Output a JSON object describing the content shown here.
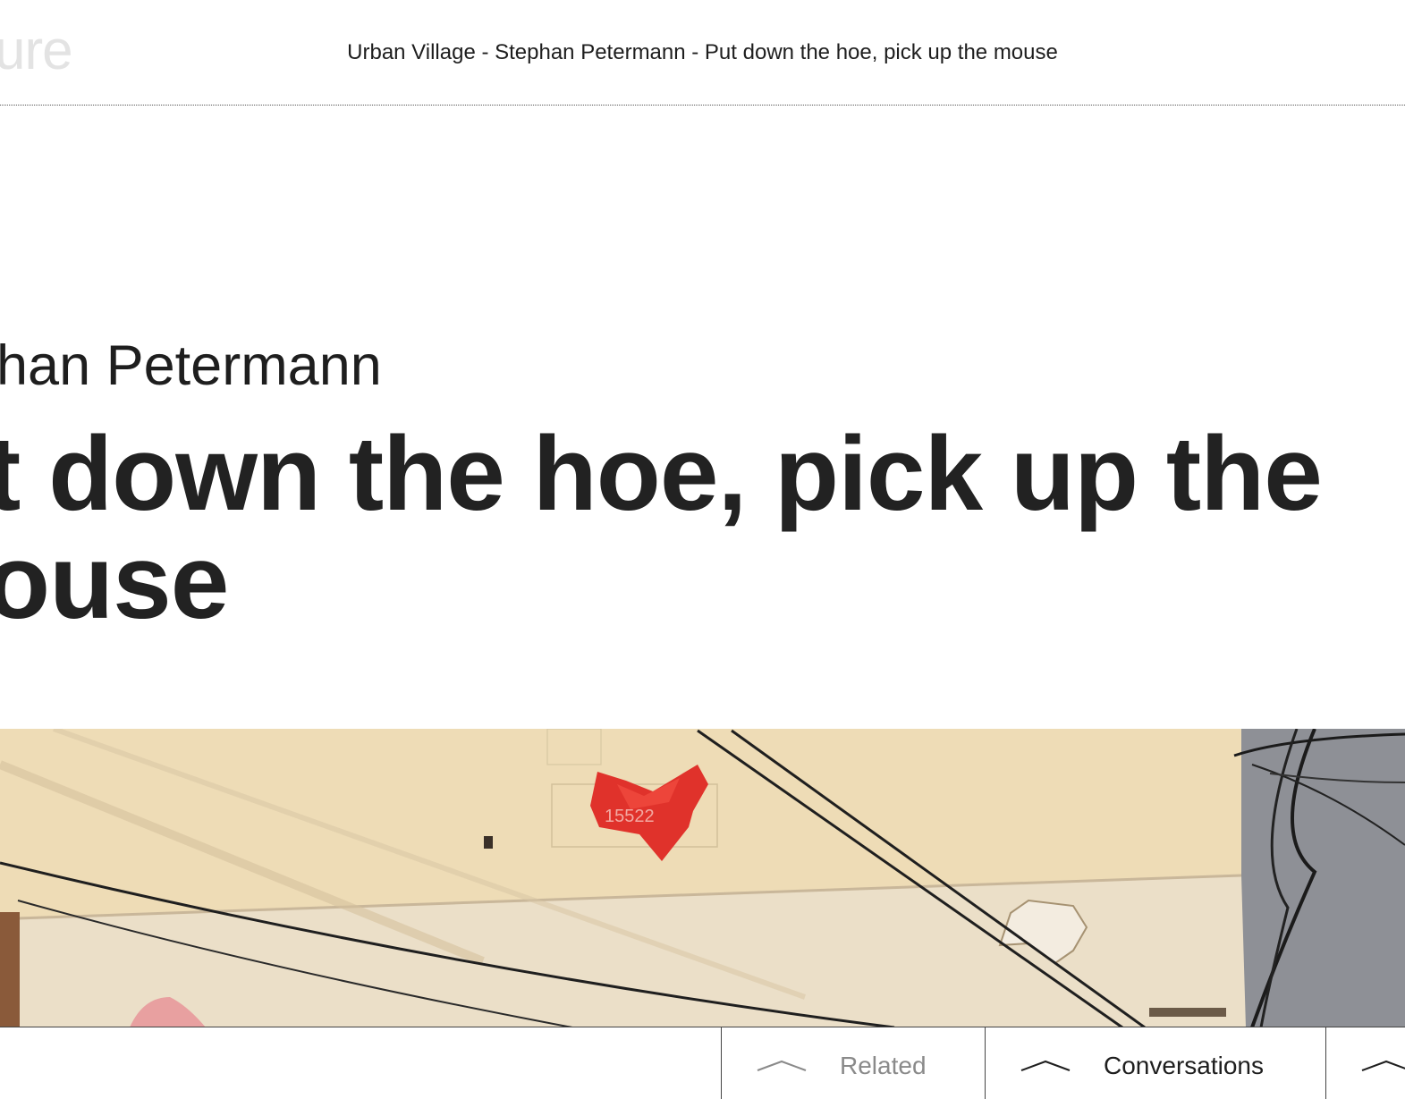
{
  "header": {
    "logo_fragment": "ure",
    "title": "Urban Village - Stephan Petermann - Put down the hoe, pick up the mouse"
  },
  "article": {
    "author": "han Petermann",
    "headline_lines": [
      "t down the hoe, pick up the",
      "ouse"
    ]
  },
  "photo": {
    "description_icon": "hero-photo",
    "sign_text": "15522"
  },
  "tabs": [
    {
      "label": "Related",
      "icon": "chevron-up-icon",
      "state": "inactive"
    },
    {
      "label": "Conversations",
      "icon": "chevron-up-icon",
      "state": "active"
    },
    {
      "label": "",
      "icon": "chevron-up-icon",
      "state": "active"
    }
  ],
  "colors": {
    "text": "#222222",
    "muted": "#8a8a8a",
    "logo": "#e3e3e3",
    "wall": "#eddcb8",
    "sky": "#8e9096",
    "red_bag": "#e0322b"
  }
}
